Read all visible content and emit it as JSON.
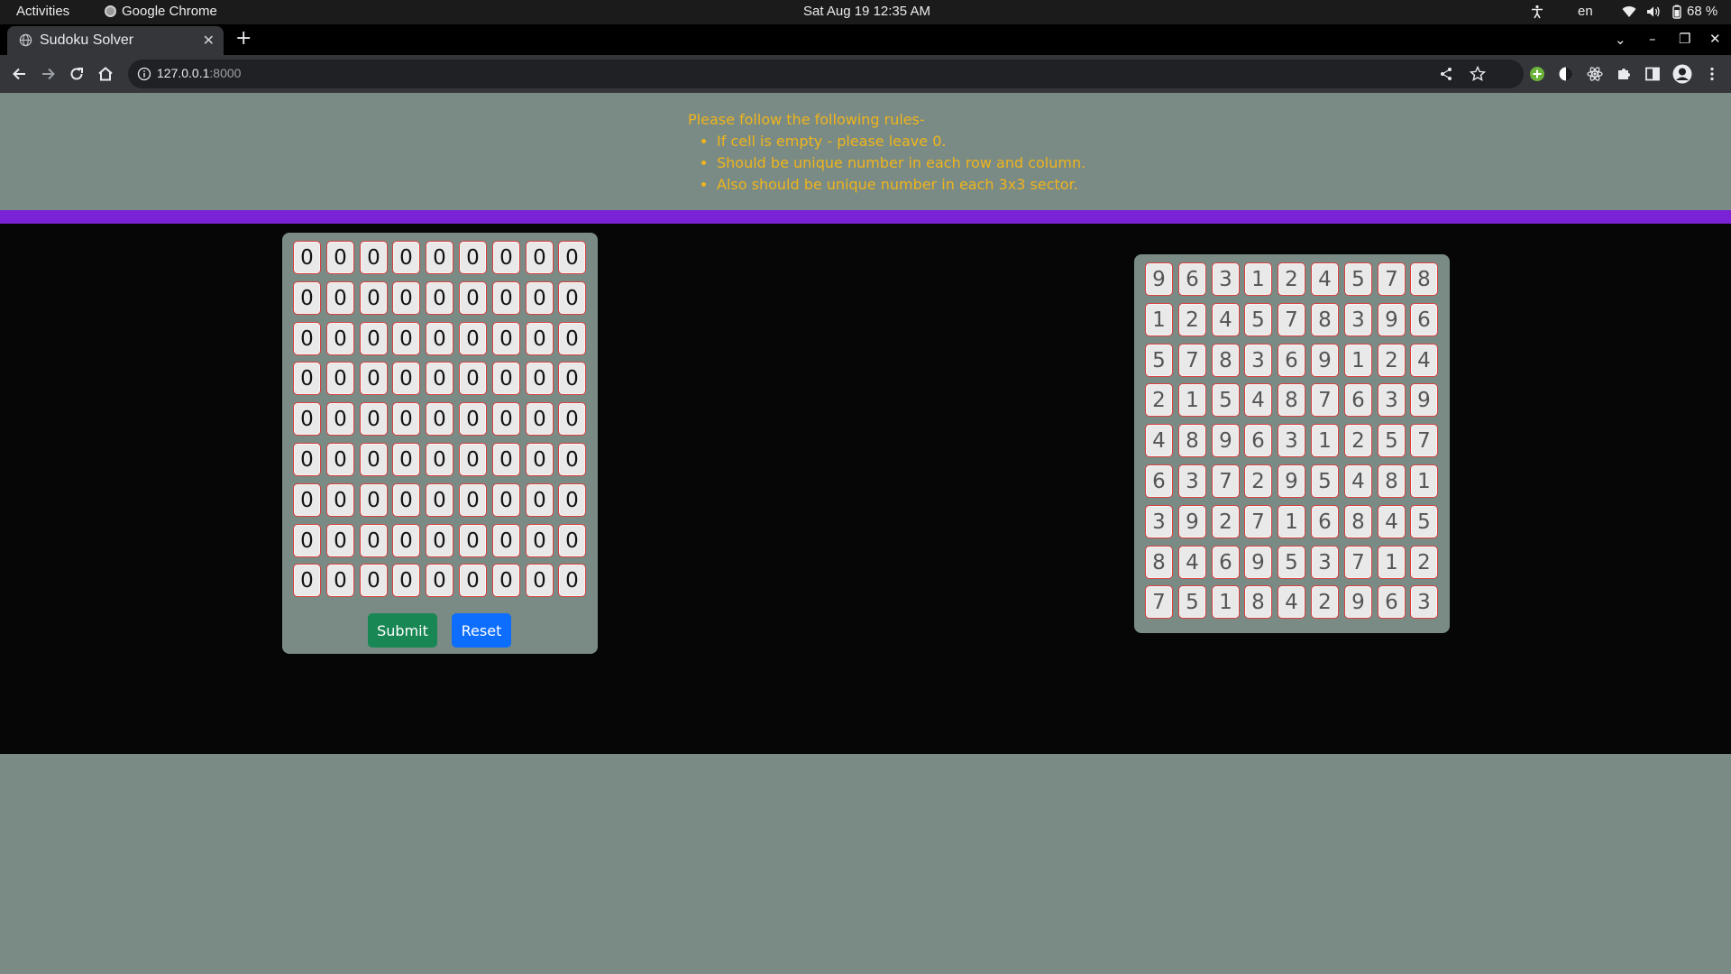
{
  "system_bar": {
    "activities": "Activities",
    "app_name": "Google Chrome",
    "datetime": "Sat Aug 19  12:35 AM",
    "language": "en",
    "battery": "68 %"
  },
  "browser": {
    "tab_title": "Sudoku Solver",
    "url_host": "127.0.0.1",
    "url_port": ":8000"
  },
  "rules": {
    "heading": "Please follow the following rules-",
    "items": [
      "If cell is empty - please leave 0.",
      "Should be unique number in each row and column.",
      "Also should be unique number in each 3x3 sector."
    ]
  },
  "input_grid": [
    [
      "0",
      "0",
      "0",
      "0",
      "0",
      "0",
      "0",
      "0",
      "0"
    ],
    [
      "0",
      "0",
      "0",
      "0",
      "0",
      "0",
      "0",
      "0",
      "0"
    ],
    [
      "0",
      "0",
      "0",
      "0",
      "0",
      "0",
      "0",
      "0",
      "0"
    ],
    [
      "0",
      "0",
      "0",
      "0",
      "0",
      "0",
      "0",
      "0",
      "0"
    ],
    [
      "0",
      "0",
      "0",
      "0",
      "0",
      "0",
      "0",
      "0",
      "0"
    ],
    [
      "0",
      "0",
      "0",
      "0",
      "0",
      "0",
      "0",
      "0",
      "0"
    ],
    [
      "0",
      "0",
      "0",
      "0",
      "0",
      "0",
      "0",
      "0",
      "0"
    ],
    [
      "0",
      "0",
      "0",
      "0",
      "0",
      "0",
      "0",
      "0",
      "0"
    ],
    [
      "0",
      "0",
      "0",
      "0",
      "0",
      "0",
      "0",
      "0",
      "0"
    ]
  ],
  "solution_grid": [
    [
      "9",
      "6",
      "3",
      "1",
      "2",
      "4",
      "5",
      "7",
      "8"
    ],
    [
      "1",
      "2",
      "4",
      "5",
      "7",
      "8",
      "3",
      "9",
      "6"
    ],
    [
      "5",
      "7",
      "8",
      "3",
      "6",
      "9",
      "1",
      "2",
      "4"
    ],
    [
      "2",
      "1",
      "5",
      "4",
      "8",
      "7",
      "6",
      "3",
      "9"
    ],
    [
      "4",
      "8",
      "9",
      "6",
      "3",
      "1",
      "2",
      "5",
      "7"
    ],
    [
      "6",
      "3",
      "7",
      "2",
      "9",
      "5",
      "4",
      "8",
      "1"
    ],
    [
      "3",
      "9",
      "2",
      "7",
      "1",
      "6",
      "8",
      "4",
      "5"
    ],
    [
      "8",
      "4",
      "6",
      "9",
      "5",
      "3",
      "7",
      "1",
      "2"
    ],
    [
      "7",
      "5",
      "1",
      "8",
      "4",
      "2",
      "9",
      "6",
      "3"
    ]
  ],
  "buttons": {
    "submit": "Submit",
    "reset": "Reset"
  },
  "colors": {
    "page_bg": "#798b84",
    "rules_text": "#f0b41c",
    "accent_bar": "#7a22d6",
    "submit_bg": "#198754",
    "reset_bg": "#0d6efd",
    "cell_border": "#d94040"
  }
}
